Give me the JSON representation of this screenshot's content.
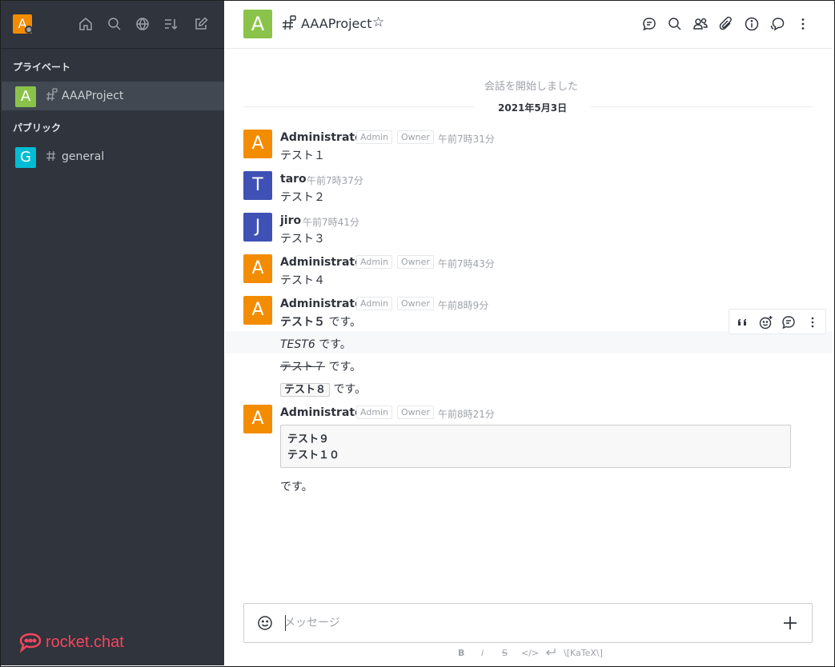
{
  "sidebar": {
    "user_initial": "A",
    "sections": [
      {
        "title": "プライベート"
      },
      {
        "title": "パブリック"
      }
    ],
    "rooms": [
      {
        "initial": "A",
        "name": "AAAProject",
        "color": "#8bc34a"
      },
      {
        "initial": "G",
        "name": "general",
        "color": "#00bcd4"
      }
    ],
    "logo_text": "rocket.chat"
  },
  "header": {
    "room_initial": "A",
    "room_name": "AAAProject"
  },
  "conversation": {
    "start_label": "会話を開始しました",
    "date": "2021年5月3日"
  },
  "roles": {
    "admin": "Admin",
    "owner": "Owner"
  },
  "messages": [
    {
      "initial": "A",
      "user": "Administrator",
      "time": "午前7時31分",
      "text": "テスト１",
      "color": "#f38c00"
    },
    {
      "initial": "T",
      "user": "taro",
      "time": "午前7時37分",
      "text": "テスト２",
      "color": "#3f51b5"
    },
    {
      "initial": "J",
      "user": "jiro",
      "time": "午前7時41分",
      "text": "テスト３",
      "color": "#3f51b5"
    },
    {
      "initial": "A",
      "user": "Administrator",
      "time": "午前7時43分",
      "text": "テスト４",
      "color": "#f38c00"
    },
    {
      "initial": "A",
      "user": "Administrator",
      "time": "午前8時9分",
      "color": "#f38c00",
      "bold": "テスト５",
      "suffix": " です。",
      "italic_line": "TEST6",
      "italic_suffix": " です。",
      "strike_line": "テスト７",
      "strike_suffix": " です。",
      "code_line": "テスト８",
      "code_suffix": " です。"
    },
    {
      "initial": "A",
      "user": "Administrator",
      "time": "午前8時21分",
      "color": "#f38c00",
      "code_block": [
        "テスト９",
        "テスト１０"
      ],
      "after": "です。"
    }
  ],
  "composer": {
    "placeholder": "メッセージ",
    "format_bold": "B",
    "format_italic": "i",
    "format_strike": "S",
    "format_code": "</>",
    "format_katex": "\\[KaTeX\\]"
  }
}
